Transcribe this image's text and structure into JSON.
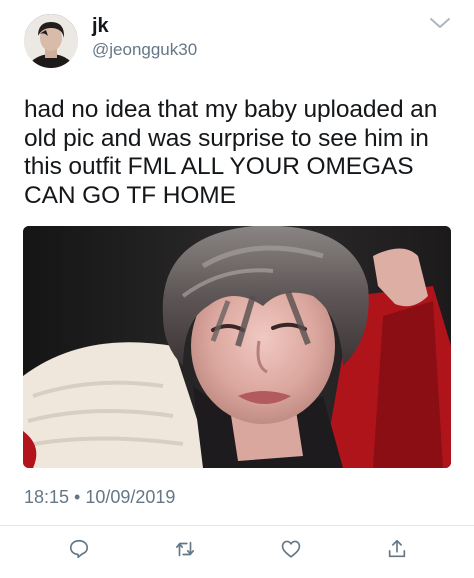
{
  "tweet": {
    "display_name": "jk",
    "handle": "@jeongguk30",
    "text": "had no idea that my baby uploaded an\nold pic and was surprise to see him in\nthis outfit FML ALL YOUR OMEGAS\nCAN GO TF HOME",
    "timestamp": "18:15 • 10/09/2019"
  },
  "icons": {
    "menu": "chevron-down",
    "reply": "comment-bubble",
    "retweet": "retweet-arrows",
    "like": "heart-outline",
    "share": "share-upload"
  },
  "colors": {
    "text": "#14171a",
    "secondary": "#657786",
    "divider": "#e1e8ed",
    "icon": "#657786"
  }
}
